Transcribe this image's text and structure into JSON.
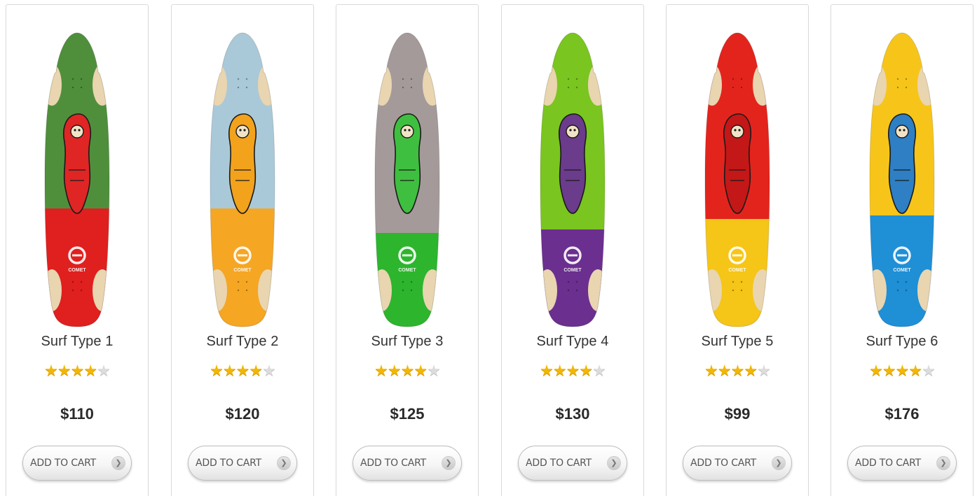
{
  "products": [
    {
      "name": "Surf Type 1",
      "rating": 4,
      "max_rating": 5,
      "price": "$110",
      "cart_label": "ADD TO CART",
      "brand": "COMET",
      "colors": {
        "top": "#4f8f3c",
        "bottom": "#e01f1f",
        "art": "#e02525"
      }
    },
    {
      "name": "Surf Type 2",
      "rating": 4,
      "max_rating": 5,
      "price": "$120",
      "cart_label": "ADD TO CART",
      "brand": "COMET",
      "colors": {
        "top": "#a9c9d8",
        "bottom": "#f5a623",
        "art": "#f2a21b"
      }
    },
    {
      "name": "Surf Type 3",
      "rating": 4,
      "max_rating": 5,
      "price": "$125",
      "cart_label": "ADD TO CART",
      "brand": "COMET",
      "colors": {
        "top": "#a49a9a",
        "bottom": "#2db52d",
        "art": "#3fbf3f"
      }
    },
    {
      "name": "Surf Type 4",
      "rating": 4,
      "max_rating": 5,
      "price": "$130",
      "cart_label": "ADD TO CART",
      "brand": "COMET",
      "colors": {
        "top": "#7ac51f",
        "bottom": "#6b2f8f",
        "art": "#6b3b8c"
      }
    },
    {
      "name": "Surf Type 5",
      "rating": 4,
      "max_rating": 5,
      "price": "$99",
      "cart_label": "ADD TO CART",
      "brand": "COMET",
      "colors": {
        "top": "#e3241d",
        "bottom": "#f5c518",
        "art": "#c41717"
      }
    },
    {
      "name": "Surf Type 6",
      "rating": 4,
      "max_rating": 5,
      "price": "$176",
      "cart_label": "ADD TO CART",
      "brand": "COMET",
      "colors": {
        "top": "#f7c51a",
        "bottom": "#1f8fd6",
        "art": "#2e7fc4"
      }
    }
  ],
  "icons": {
    "star": "star-icon",
    "cart_arrow": "chevron-right-icon"
  }
}
